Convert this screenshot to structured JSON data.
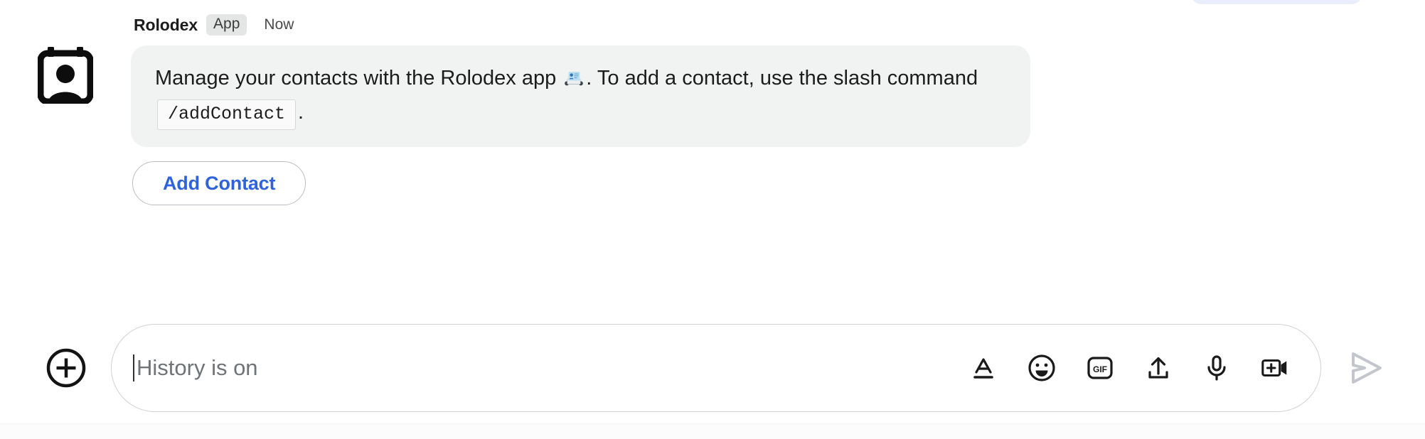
{
  "message": {
    "sender": "Rolodex",
    "badge": "App",
    "time": "Now",
    "avatar_icon": "rolodex-card-person-icon",
    "body_part1": "Manage your contacts with the Rolodex app ",
    "emoji": "card-index-emoji",
    "body_part2": ". To add a contact, use the slash command ",
    "code": "/addContact",
    "body_part3": "."
  },
  "actions": {
    "add_contact_label": "Add Contact",
    "accent_color": "#2f62dd"
  },
  "composer": {
    "plus_icon": "plus-circle-icon",
    "input_value": "",
    "placeholder": "History is on",
    "tools": [
      {
        "icon": "format-text-icon",
        "label": "Format"
      },
      {
        "icon": "emoji-smiley-icon",
        "label": "Emoji"
      },
      {
        "icon": "gif-icon",
        "label": "GIF"
      },
      {
        "icon": "upload-icon",
        "label": "Upload"
      },
      {
        "icon": "microphone-icon",
        "label": "Voice message"
      },
      {
        "icon": "video-add-icon",
        "label": "Video message"
      }
    ],
    "send_icon": "send-arrow-icon",
    "send_disabled_color": "#c3c7cd"
  },
  "colors": {
    "bubble_bg": "#f1f2f2",
    "badge_bg": "#e4e6e6",
    "border": "#cfd2d4",
    "text": "#1c1c1c",
    "placeholder": "#6f7478"
  }
}
